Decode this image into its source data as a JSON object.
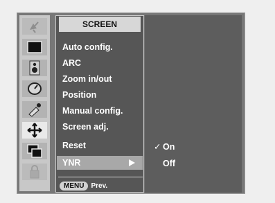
{
  "menu": {
    "title": "SCREEN",
    "items": [
      {
        "label": "Auto config."
      },
      {
        "label": "ARC"
      },
      {
        "label": "Zoom in/out"
      },
      {
        "label": "Position"
      },
      {
        "label": "Manual config."
      },
      {
        "label": "Screen adj."
      },
      {
        "label": "Reset"
      },
      {
        "label": "YNR"
      }
    ],
    "selected_index": 7
  },
  "submenu": {
    "items": [
      {
        "label": "On",
        "checked": true
      },
      {
        "label": "Off",
        "checked": false
      }
    ],
    "check_glyph": "✓"
  },
  "footer": {
    "key_label": "MENU",
    "action_label": "Prev."
  },
  "side_icons": [
    "satellite-dish-icon",
    "picture-icon",
    "speaker-icon",
    "clock-icon",
    "special-tool-icon",
    "screen-adjust-icon",
    "pip-icon",
    "lock-icon"
  ],
  "colors": {
    "osd_background": "#777777",
    "menu_panel": "#565656",
    "title_bar": "#d7d7d7",
    "selected_row": "#a8a8a8",
    "text": "#ffffff"
  }
}
